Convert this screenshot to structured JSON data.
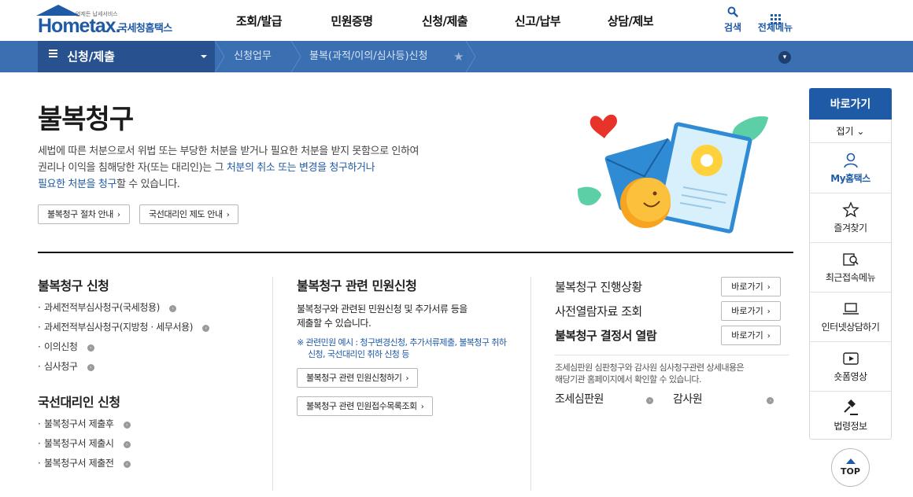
{
  "header": {
    "logo_tagline": "언제든 납세서비스",
    "logo_brand": "Hometax.",
    "logo_sub": "국세청홈택스",
    "gnb": [
      "조회/발급",
      "민원증명",
      "신청/제출",
      "신고/납부",
      "상담/제보"
    ],
    "search_label": "검색",
    "all_menu_label": "전체메뉴"
  },
  "locbar": {
    "menu": "신청/제출",
    "crumbs": [
      "신청업무",
      "불복(과적/이의/심사등)신청"
    ]
  },
  "hero": {
    "title": "불복청구",
    "desc_line1": "세법에 따른 처분으로서 위법 또는 부당한 처분을 받거나 필요한 처분을 받지 못함으로 인하여",
    "desc_line2_a": "권리나 이익을 침해당한 자(또는 대리인)는 그 ",
    "desc_line2_b": "처분의 취소 또는 변경을 청구하거나",
    "desc_line3_a": "필요한 처분을 청구",
    "desc_line3_b": "할 수 있습니다.",
    "btn1": "불복청구 절차 안내",
    "btn2": "국선대리인 제도 안내"
  },
  "left": {
    "title1": "불복청구 신청",
    "list1": [
      "과세전적부심사청구(국세청용)",
      "과세전적부심사청구(지방청 · 세무서용)",
      "이의신청",
      "심사청구"
    ],
    "title2": "국선대리인 신청",
    "list2": [
      "불복청구서 제출후",
      "불복청구서 제출시",
      "불복청구서 제출전"
    ]
  },
  "middle": {
    "title": "불복청구 관련 민원신청",
    "desc1": "불복청구와 관련된 민원신청 및 추가서류 등을",
    "desc2": "제출할 수 있습니다.",
    "note1": "※ 관련민원 예시 : 청구변경신청, 추가서류제출, 불복청구 취하",
    "note2": "신청, 국선대리인 취하 신청 등",
    "btn1": "불복청구 관련 민원신청하기",
    "btn2": "불복청구 관련 민원접수목록조회"
  },
  "right": {
    "item1": "불복청구 진행상황",
    "item2": "사전열람자료 조회",
    "item3": "불복청구 결정서 열람",
    "goto": "바로가기",
    "note1": "조세심판원 심판청구와 감사원 심사청구관련 상세내용은",
    "note2": "해당기관 홈페이지에서 확인할 수 있습니다.",
    "org1": "조세심판원",
    "org2": "감사원"
  },
  "quick": {
    "head": "바로가기",
    "fold": "접기",
    "items": [
      "My홈택스",
      "즐겨찾기",
      "최근접속메뉴",
      "인터넷상담하기",
      "숏폼영상",
      "법령정보"
    ],
    "top": "TOP"
  },
  "colors": {
    "brand": "#1f5aa6",
    "locbar": "#3a6fb2",
    "locbar_dark": "#27528f"
  }
}
